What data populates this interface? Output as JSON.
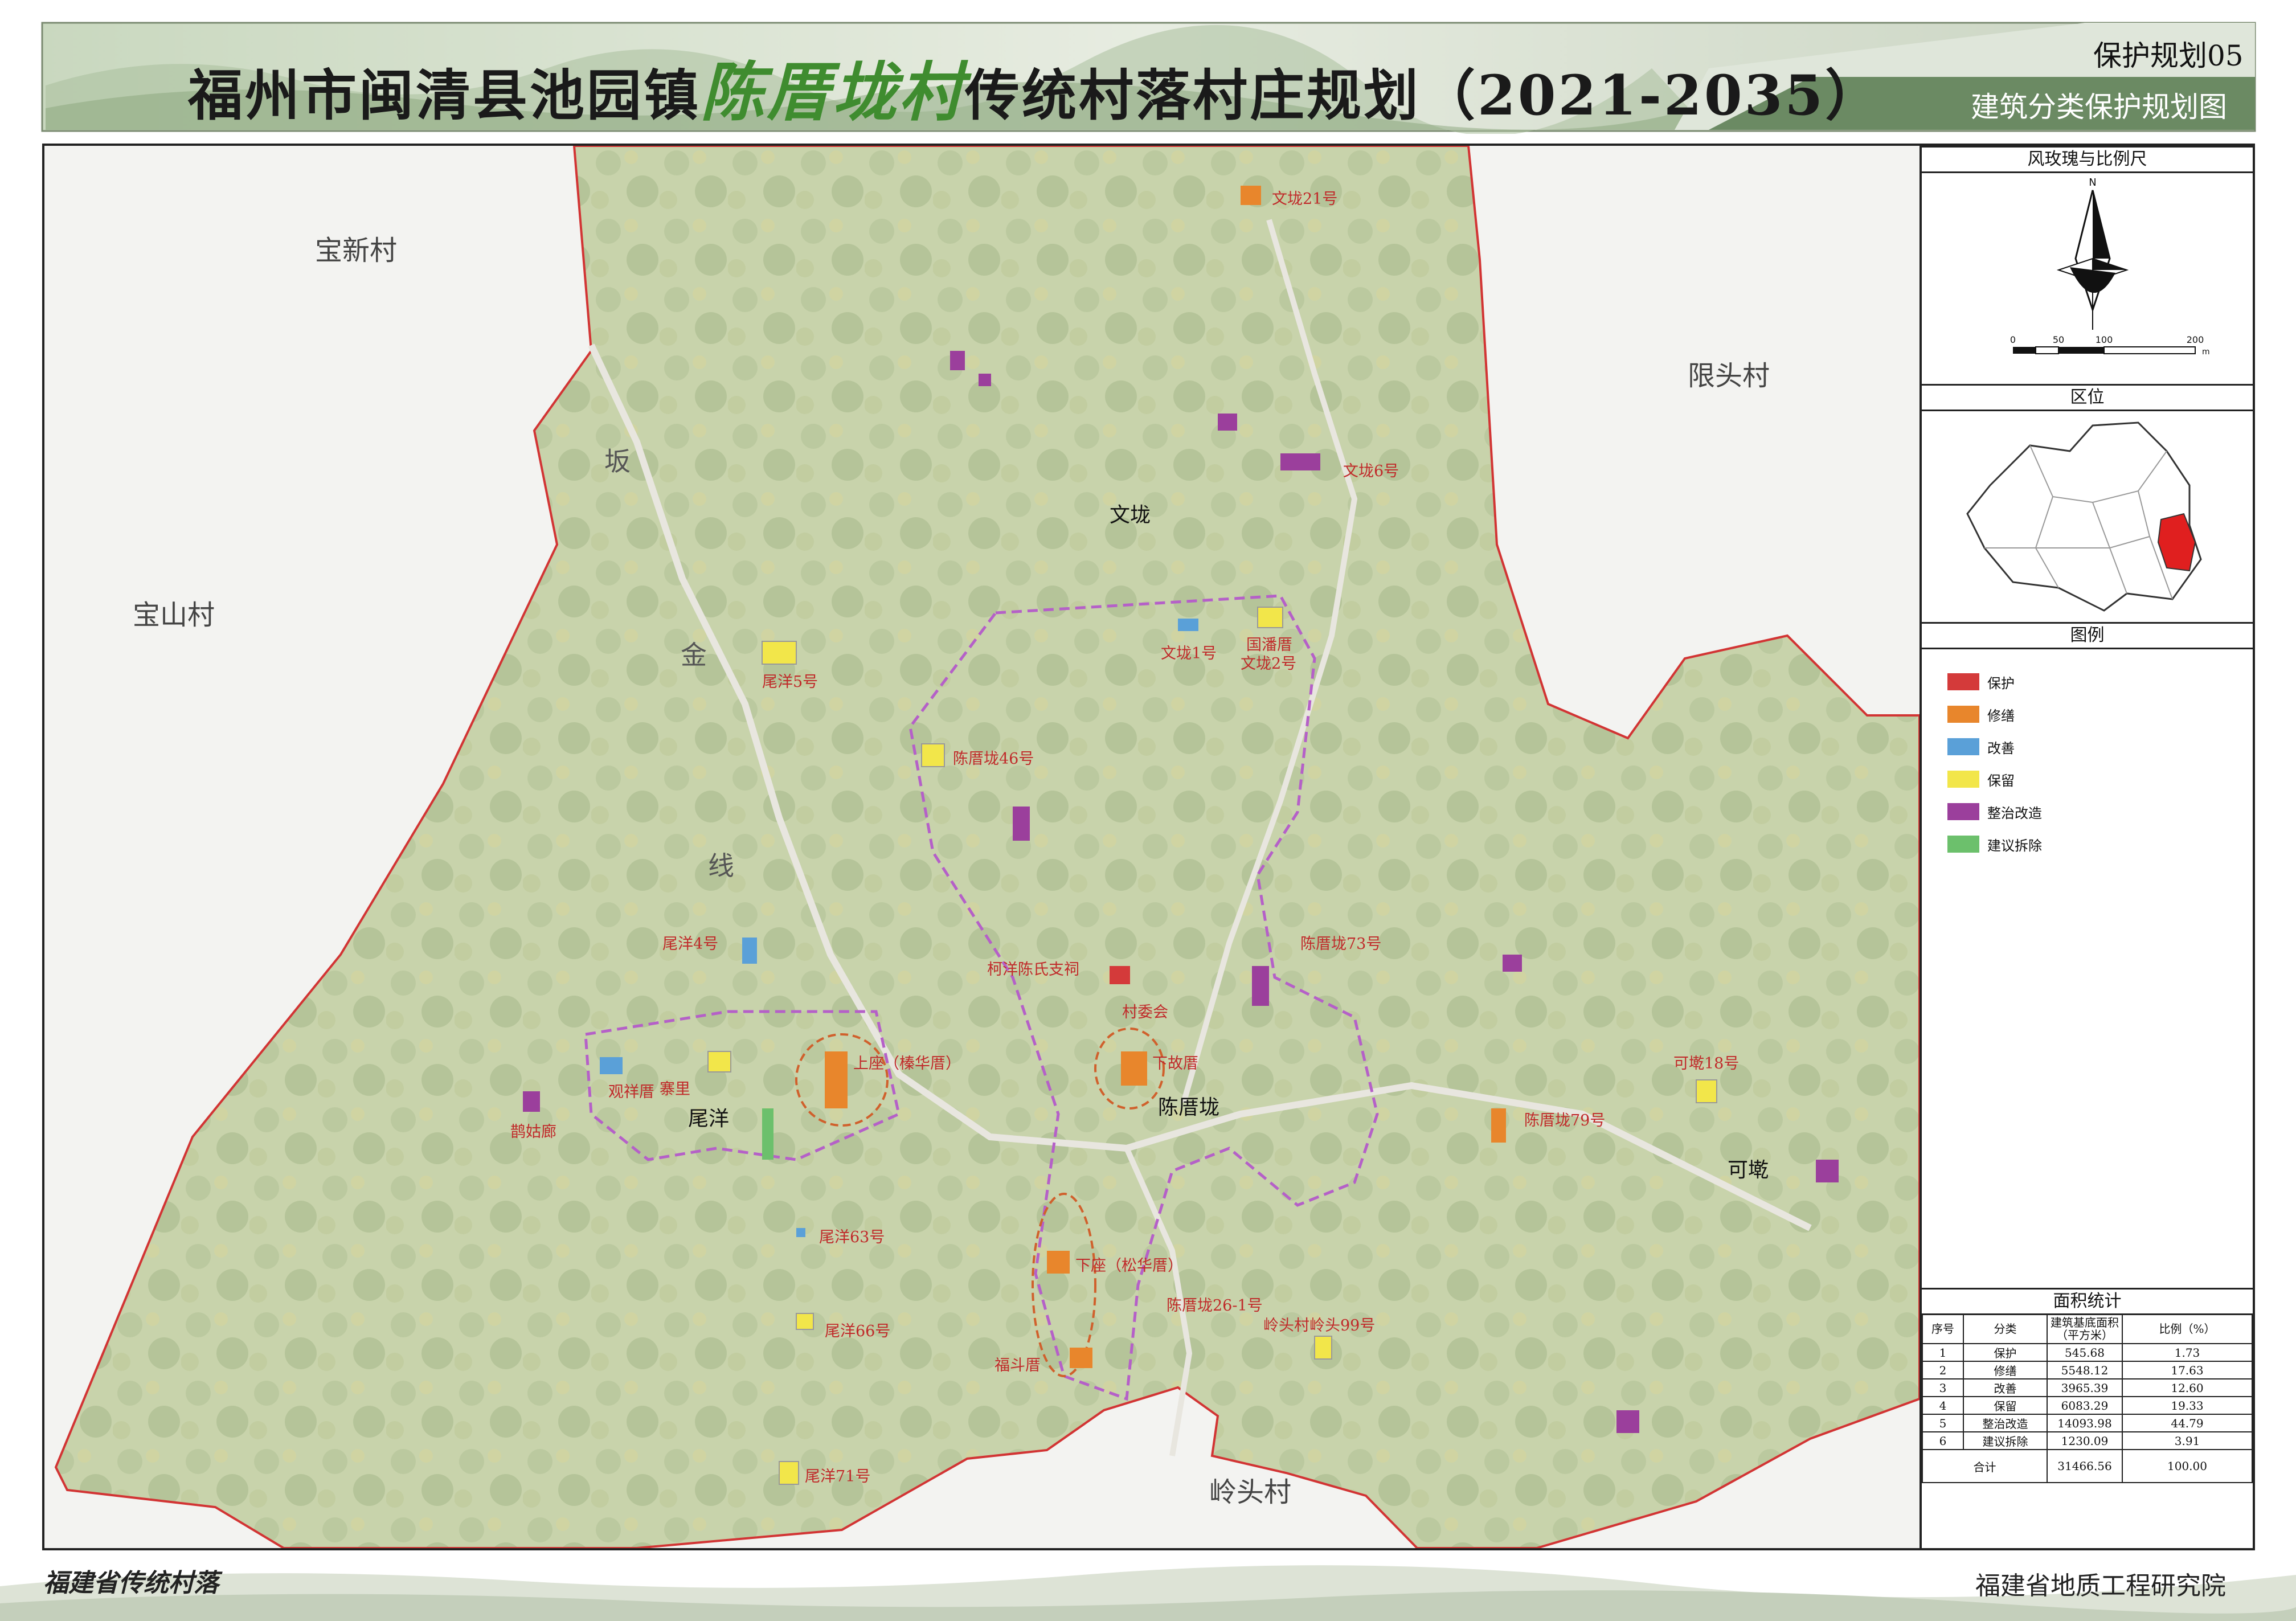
{
  "header": {
    "title_prefix": "福州市闽清县池园镇",
    "title_village": "陈厝垅村",
    "title_suffix": "传统村落村庄规划（2021-2035）",
    "plan_number": "保护规划05",
    "plan_name": "建筑分类保护规划图"
  },
  "map": {
    "neighbor_villages": [
      "宝新村",
      "限头村",
      "宝山村",
      "岭头村"
    ],
    "road_label_chars": [
      "坂",
      "金",
      "线"
    ],
    "settlements": [
      "文垅",
      "尾洋",
      "陈厝垅",
      "可墘"
    ],
    "building_labels": [
      "文垅21号",
      "文垅6号",
      "文垅1号",
      "国潘厝",
      "文垅2号",
      "尾洋5号",
      "陈厝垅46号",
      "尾洋4号",
      "柯洋陈氏支祠",
      "村委会",
      "陈厝垅73号",
      "观祥厝",
      "寨里",
      "上座（榛华厝）",
      "下故厝",
      "鹊姑廊",
      "可墘18号",
      "陈厝垅79号",
      "尾洋63号",
      "下座（松华厝）",
      "陈厝垅26-1号",
      "岭头村岭头99号",
      "尾洋66号",
      "福斗厝",
      "尾洋71号"
    ],
    "category_colors": {
      "protect": "#d43a3a",
      "repair": "#e8862c",
      "improve": "#5aa0d8",
      "retain": "#f2e64a",
      "rectify": "#9b3f9c",
      "demolish": "#6cc06c"
    }
  },
  "sidebar": {
    "compass_title": "风玫瑰与比例尺",
    "north_label": "N",
    "scale_ticks": [
      "0",
      "50",
      "100",
      "200"
    ],
    "scale_unit": "m",
    "location_title": "区位",
    "legend_title": "图例",
    "legend": [
      {
        "label": "保护",
        "color": "#d43a3a"
      },
      {
        "label": "修缮",
        "color": "#e8862c"
      },
      {
        "label": "改善",
        "color": "#5aa0d8"
      },
      {
        "label": "保留",
        "color": "#f2e64a"
      },
      {
        "label": "整治改造",
        "color": "#9b3f9c"
      },
      {
        "label": "建议拆除",
        "color": "#6cc06c"
      }
    ],
    "stats_title": "面积统计",
    "stats_headers": [
      "序号",
      "分类",
      "建筑基底面积（平方米）",
      "比例（%）"
    ],
    "stats_rows": [
      [
        "1",
        "保护",
        "545.68",
        "1.73"
      ],
      [
        "2",
        "修缮",
        "5548.12",
        "17.63"
      ],
      [
        "3",
        "改善",
        "3965.39",
        "12.60"
      ],
      [
        "4",
        "保留",
        "6083.29",
        "19.33"
      ],
      [
        "5",
        "整治改造",
        "14093.98",
        "44.79"
      ],
      [
        "6",
        "建议拆除",
        "1230.09",
        "3.91"
      ]
    ],
    "stats_total_label": "合计",
    "stats_total_area": "31466.56",
    "stats_total_ratio": "100.00"
  },
  "footer": {
    "left_text": "福建省传统村落",
    "right_text": "福建省地质工程研究院"
  }
}
